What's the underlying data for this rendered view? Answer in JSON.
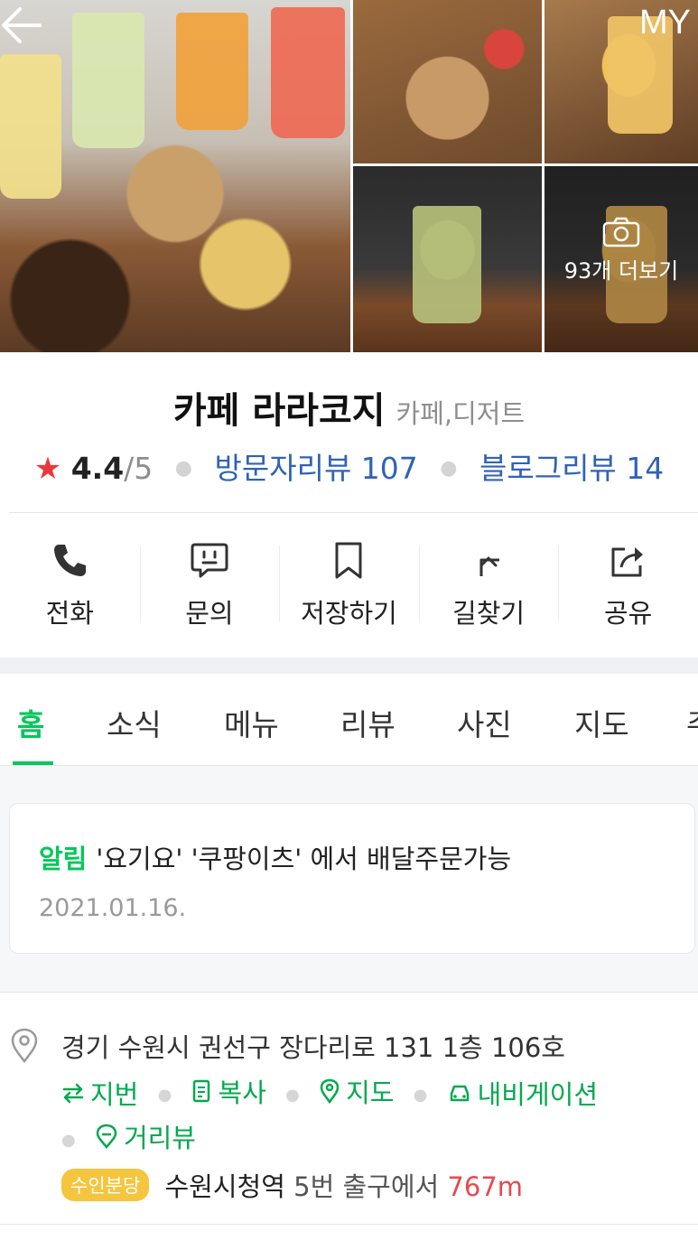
{
  "header": {
    "my_label": "MY",
    "photo_more": "93개 더보기"
  },
  "place": {
    "name": "카페 라라코지",
    "category": "카페,디저트",
    "rating": "4.4",
    "rating_max": "/5",
    "visitor_reviews": "방문자리뷰 107",
    "blog_reviews": "블로그리뷰 14"
  },
  "actions": [
    {
      "label": "전화",
      "icon": "phone-icon"
    },
    {
      "label": "문의",
      "icon": "chat-icon"
    },
    {
      "label": "저장하기",
      "icon": "bookmark-icon"
    },
    {
      "label": "길찾기",
      "icon": "directions-icon"
    },
    {
      "label": "공유",
      "icon": "share-icon"
    }
  ],
  "tabs": [
    "홈",
    "소식",
    "메뉴",
    "리뷰",
    "사진",
    "지도",
    "주"
  ],
  "active_tab": "홈",
  "notice": {
    "tag": "알림",
    "text": "'요기요' '쿠팡이츠' 에서 배달주문가능",
    "date": "2021.01.16."
  },
  "address": {
    "text": "경기 수원시 권선구 장다리로 131 1층 106호",
    "links": [
      "지번",
      "복사",
      "지도",
      "내비게이션",
      "거리뷰"
    ],
    "subway_line": "수인분당",
    "station": "수원시청역",
    "exit_text": "5번 출구에서",
    "distance": "767m"
  },
  "colors": {
    "accent_green": "#03c75a",
    "link_blue": "#3063b4",
    "star_red": "#e6393e",
    "subway_yellow": "#f5c53d"
  }
}
